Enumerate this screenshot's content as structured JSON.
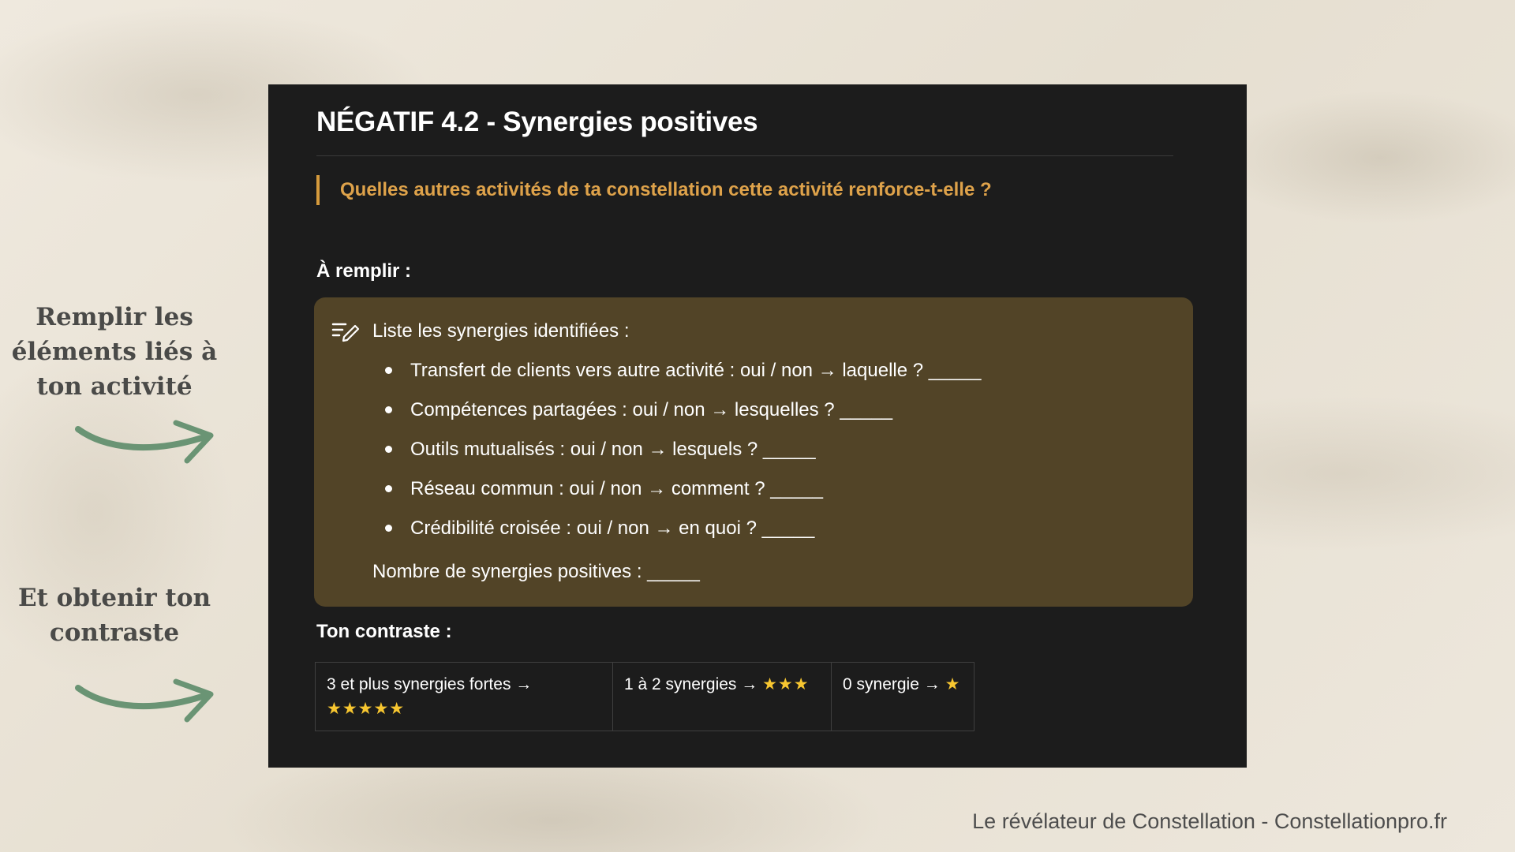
{
  "side_notes": {
    "fill_hint": [
      "Remplir les",
      "éléments liés à",
      "ton activité"
    ],
    "result_hint": [
      "Et obtenir ton",
      "contraste"
    ]
  },
  "panel": {
    "title": "NÉGATIF 4.2 - Synergies positives",
    "question": "Quelles autres activités de ta constellation cette activité renforce-t-elle ?",
    "fill_label": "À remplir :",
    "fill_box": {
      "header_icon": "edit-list-icon",
      "header": "Liste les synergies identifiées :",
      "items": [
        "Transfert de clients vers autre activité : oui / non → laquelle ? _____",
        "Compétences partagées : oui / non → lesquelles ? _____",
        "Outils mutualisés : oui / non → lesquels ? _____",
        "Réseau commun : oui / non → comment ? _____",
        "Crédibilité croisée : oui / non → en quoi ? _____"
      ],
      "count_line": "Nombre de synergies positives : _____"
    },
    "contrast_label": "Ton contraste :",
    "contrast_table": [
      {
        "text": "3 et plus synergies fortes →",
        "stars": "★★★★★"
      },
      {
        "text": "1 à 2 synergies →",
        "stars": "★★★"
      },
      {
        "text": "0 synergie →",
        "stars": "★"
      }
    ]
  },
  "footer": "Le révélateur de Constellation - Constellationpro.fr",
  "colors": {
    "panel_bg": "#1c1c1c",
    "accent_orange": "#dea24a",
    "fill_box_bg": "#524427",
    "arrow_green": "#6a9474",
    "star_yellow": "#f7c630"
  }
}
